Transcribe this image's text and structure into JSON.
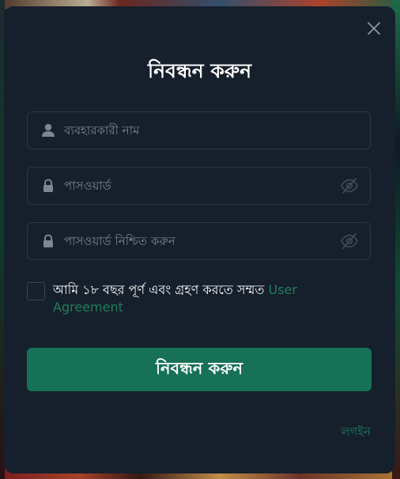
{
  "modal": {
    "title": "নিবন্ধন করুন",
    "fields": {
      "username": {
        "placeholder": "ব্যবহারকারী নাম",
        "value": ""
      },
      "password": {
        "placeholder": "পাসওয়ার্ড",
        "value": ""
      },
      "confirm_password": {
        "placeholder": "পাসওয়ার্ড নিশ্চিত করুন",
        "value": ""
      }
    },
    "agreement": {
      "text": "আমি ১৮ বছর পূর্ণ এবং গ্রহণ করতে সম্মত ",
      "link": "User Agreement",
      "checked": false
    },
    "submit_label": "নিবন্ধন করুন",
    "login_label": "লগইন"
  },
  "icons": {
    "close": "close-icon",
    "user": "user-icon",
    "lock": "lock-icon",
    "eye_off": "eye-off-icon"
  },
  "colors": {
    "modal_bg": "#161f2c",
    "accent": "#167156",
    "link": "#1e7f5a",
    "border": "#2b3646",
    "placeholder": "#7b8796"
  }
}
